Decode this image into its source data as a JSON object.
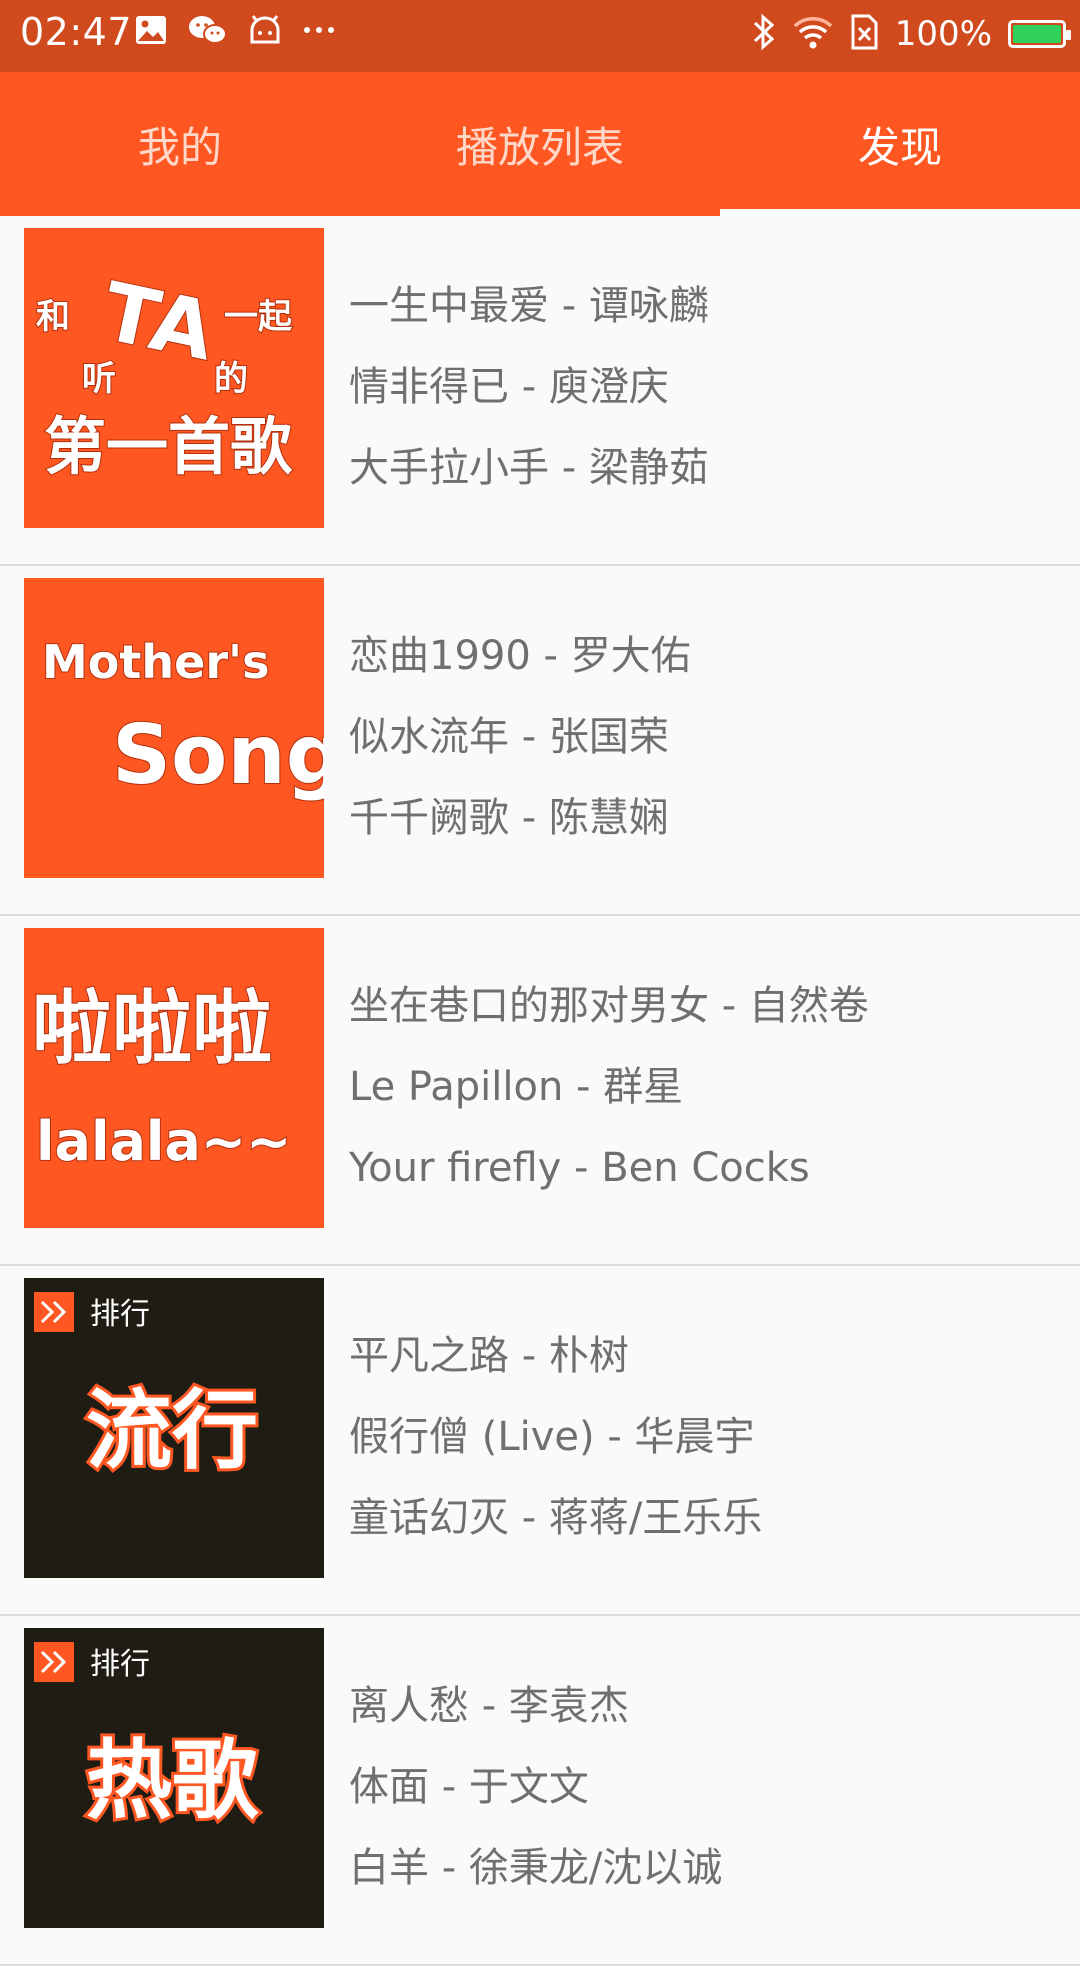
{
  "status_bar": {
    "time": "02:47",
    "battery_text": "100%",
    "icons_left": [
      "image-icon",
      "wechat-icon",
      "android-icon",
      "more-dots-icon"
    ],
    "icons_right": [
      "bluetooth-icon",
      "wifi-icon",
      "sim-icon",
      "battery-icon"
    ],
    "colors": {
      "background": "#d14a1e",
      "battery_fill": "#2fd15a"
    }
  },
  "tabs": {
    "items": [
      {
        "label": "我的",
        "active": false
      },
      {
        "label": "播放列表",
        "active": false
      },
      {
        "label": "发现",
        "active": true
      }
    ],
    "colors": {
      "background": "#ff5722",
      "active_text": "#ffffff",
      "inactive_text": "#ffd8c9"
    }
  },
  "playlists": [
    {
      "cover": {
        "style": "orange",
        "lines": [
          "和",
          "TA",
          "一起",
          "听",
          "的",
          "第一首歌"
        ]
      },
      "songs": [
        "一生中最爱 - 谭咏麟",
        "情非得已 - 庾澄庆",
        "大手拉小手 - 梁静茹"
      ]
    },
    {
      "cover": {
        "style": "orange",
        "lines": [
          "Mother's",
          "Song"
        ]
      },
      "songs": [
        "恋曲1990 - 罗大佑",
        "似水流年 - 张国荣",
        "千千阙歌 - 陈慧娴"
      ]
    },
    {
      "cover": {
        "style": "orange",
        "lines": [
          "啦啦啦",
          "lalala~~"
        ]
      },
      "songs": [
        "坐在巷口的那对男女 - 自然卷",
        "Le Papillon - 群星",
        "Your firefly - Ben Cocks"
      ]
    },
    {
      "cover": {
        "style": "dark",
        "badge": "排行",
        "title": "流行"
      },
      "songs": [
        "平凡之路 - 朴树",
        "假行僧 (Live) - 华晨宇",
        "童话幻灭 - 蒋蒋/王乐乐"
      ]
    },
    {
      "cover": {
        "style": "dark",
        "badge": "排行",
        "title": "热歌"
      },
      "songs": [
        "离人愁 - 李袁杰",
        "体面 - 于文文",
        "白羊 - 徐秉龙/沈以诚"
      ]
    }
  ],
  "colors": {
    "cover_orange": "#ff5722",
    "cover_dark": "#1f1c13",
    "song_text": "#6f6f6f"
  }
}
